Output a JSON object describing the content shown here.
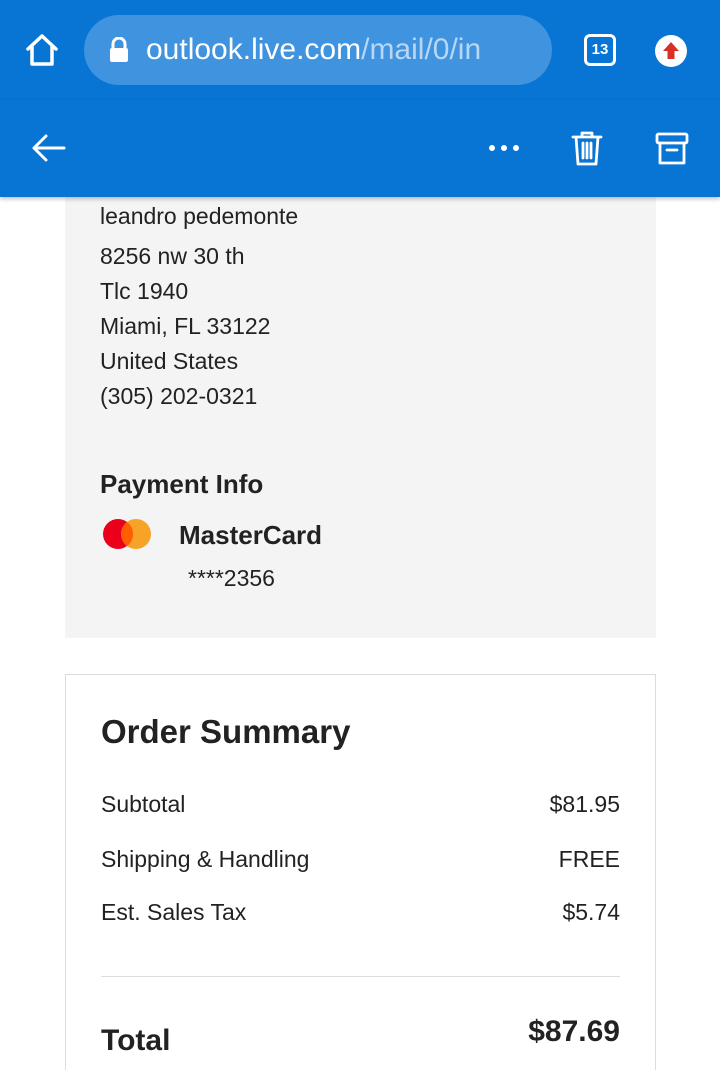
{
  "browser": {
    "url_domain": "outlook.live.com",
    "url_path": "/mail/0/in",
    "tab_count": "13",
    "icons": {
      "home": "home-icon",
      "lock": "lock-icon",
      "tabs": "tabs-icon",
      "update": "update-arrow-icon"
    },
    "colors": {
      "bar": "#0874d4",
      "pill": "#3f93df",
      "update_badge": "#d93025"
    }
  },
  "action_bar": {
    "icons": {
      "back": "back-arrow-icon",
      "more": "more-dots-icon",
      "delete": "trash-icon",
      "archive": "archive-icon"
    }
  },
  "shipping_address": {
    "lines": [
      "leandro pedemonte",
      "8256 nw 30 th",
      "Tlc 1940",
      "Miami, FL 33122",
      "United States",
      "(305) 202-0321"
    ]
  },
  "payment": {
    "title": "Payment Info",
    "card_brand": "MasterCard",
    "card_number": "****2356",
    "logo_colors": {
      "left": "#eb001b",
      "right": "#f79e1b"
    }
  },
  "order_summary": {
    "title": "Order Summary",
    "rows": [
      {
        "label": "Subtotal",
        "value": "$81.95"
      },
      {
        "label": "Shipping & Handling",
        "value": "FREE"
      },
      {
        "label": "Est. Sales Tax",
        "value": "$5.74"
      }
    ],
    "total_label": "Total",
    "total_value": "$87.69"
  }
}
